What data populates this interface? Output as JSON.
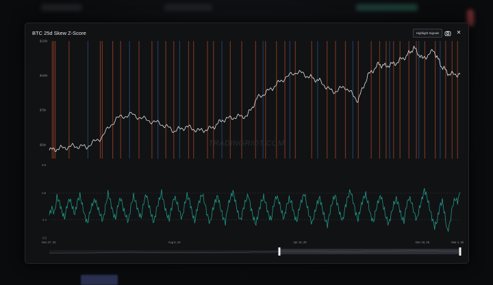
{
  "modal": {
    "title": "BTC  25d Skew Z-Score",
    "highlight_button_label": "Highlight Signals",
    "camera_icon": "camera-icon",
    "close_icon": "close-icon",
    "close_glyph": "✕"
  },
  "watermark": "TRADINGRIOT.COM",
  "colors": {
    "price_line": "#e6e6e6",
    "zscore_line": "#1f9a8a",
    "signal_red": "#c4522e",
    "signal_blue": "#2f5f96",
    "grid": "#3a3d44"
  },
  "chart_data": [
    {
      "type": "line",
      "name": "price",
      "ylim": [
        40000,
        125000
      ],
      "yticks": [
        {
          "value": 50000,
          "label": "$50k"
        },
        {
          "value": 75000,
          "label": "$75k"
        },
        {
          "value": 100000,
          "label": "$100k"
        },
        {
          "value": 125000,
          "label": "$125k"
        }
      ],
      "x": [
        "2023-11-27",
        "2023-12-20",
        "2024-01-15",
        "2024-02-10",
        "2024-03-10",
        "2024-04-10",
        "2024-05-10",
        "2024-06-10",
        "2024-07-10",
        "2024-08-05",
        "2024-08-30",
        "2024-09-25",
        "2024-10-20",
        "2024-11-10",
        "2024-12-05",
        "2024-12-30",
        "2025-01-20",
        "2025-02-15",
        "2025-03-10",
        "2025-04-10",
        "2025-05-05",
        "2025-05-25",
        "2025-06-20",
        "2025-07-15",
        "2025-08-10",
        "2025-08-30",
        "2025-09-20",
        "2025-10-06",
        "2025-10-25",
        "2025-11-15",
        "2025-12-01",
        "2025-12-18",
        "2026-01-10",
        "2026-01-25",
        "2026-02-10",
        "2026-03-04"
      ],
      "values": [
        46000,
        47500,
        49000,
        48500,
        55000,
        69000,
        72000,
        68000,
        65000,
        60000,
        63000,
        60000,
        62000,
        68000,
        70000,
        71000,
        84000,
        90000,
        97000,
        103000,
        99000,
        96000,
        88000,
        92000,
        82000,
        100000,
        108000,
        107000,
        109000,
        114000,
        120000,
        112000,
        118000,
        107000,
        101000,
        101000
      ]
    },
    {
      "type": "line",
      "name": "zscore",
      "ylim": [
        -3.1,
        5.3
      ],
      "yticks": [
        {
          "value": 4.9,
          "label": "4.9"
        },
        {
          "value": 1.8,
          "label": "1.8"
        },
        {
          "value": -1.1,
          "label": "-1.1"
        },
        {
          "value": -3.1,
          "label": "-3.1"
        }
      ],
      "dashed_levels": [
        1.8,
        -1.1
      ],
      "xticks": [
        {
          "value": "2023-11-27",
          "label": "Nov 27, 23"
        },
        {
          "value": "2024-08-05",
          "label": "Aug 5, 24"
        },
        {
          "value": "2025-04-15",
          "label": "Apr 15, 25"
        },
        {
          "value": "2025-12-18",
          "label": "Dec 18, 25"
        },
        {
          "value": "2026-03-04",
          "label": "Mar 4, 26"
        }
      ],
      "x_start": "2023-11-27",
      "x_end": "2026-03-04",
      "values": [
        -0.6,
        0.2,
        -0.4,
        1.4,
        0.8,
        -0.3,
        -0.9,
        0.5,
        1.2,
        0.3,
        -0.5,
        0.9,
        1.6,
        0.4,
        -0.8,
        -1.5,
        -0.2,
        0.7,
        1.1,
        0.2,
        -0.6,
        -1.2,
        0.3,
        1.8,
        0.9,
        -0.4,
        -1.0,
        0.6,
        1.3,
        0.1,
        -0.7,
        -1.3,
        0.4,
        1.5,
        0.7,
        -0.3,
        -0.9,
        0.8,
        1.7,
        0.5,
        -0.6,
        -1.4,
        0.0,
        1.0,
        1.9,
        0.6,
        -0.5,
        -1.1,
        0.3,
        1.4,
        0.8,
        -0.2,
        -1.0,
        0.5,
        1.6,
        1.0,
        -0.4,
        -1.3,
        0.2,
        1.1,
        1.7,
        0.6,
        -0.7,
        -1.5,
        -0.1,
        0.9,
        1.5,
        0.3,
        -0.8,
        -1.4,
        0.4,
        1.3,
        2.0,
        0.8,
        -0.5,
        -1.2,
        0.1,
        1.0,
        1.6,
        0.2,
        -0.9,
        -1.6,
        -0.3,
        0.8,
        1.4,
        0.5,
        -0.7,
        -1.1,
        0.6,
        1.5,
        0.9,
        -0.2,
        -1.0,
        0.4,
        1.2,
        0.7,
        -0.6,
        -1.3,
        0.2,
        1.1,
        1.8,
        0.4,
        -0.8,
        -1.5,
        -0.4,
        0.7,
        1.3,
        0.1,
        -1.0,
        -1.7,
        -0.2,
        0.9,
        1.6,
        0.5,
        -0.6,
        -1.2,
        0.3,
        1.4,
        2.1,
        1.0,
        -0.3,
        -1.1,
        0.2,
        1.2,
        1.7,
        0.6,
        -0.7,
        -1.4,
        0.0,
        1.0,
        1.5,
        0.3,
        -0.9,
        -1.6,
        -0.5,
        0.6,
        1.2,
        0.4,
        -0.8,
        -1.3,
        0.5,
        1.3,
        0.8,
        -0.4,
        -1.1,
        0.1,
        1.1,
        2.2,
        1.4,
        0.2,
        -0.9,
        -1.9,
        -1.2,
        0.3,
        1.0,
        -0.6,
        -2.4,
        -1.5,
        0.4,
        1.2,
        0.9,
        1.9
      ]
    }
  ],
  "signals": {
    "red_dates": [
      "2023-12-02",
      "2023-12-05",
      "2023-12-08",
      "2024-01-05",
      "2024-03-08",
      "2024-03-12",
      "2024-04-02",
      "2024-04-18",
      "2024-05-25",
      "2024-06-20",
      "2024-07-18",
      "2024-08-03",
      "2024-09-02",
      "2024-09-12",
      "2024-10-10",
      "2024-10-22",
      "2024-11-25",
      "2024-12-18",
      "2025-01-15",
      "2025-02-04",
      "2025-02-26",
      "2025-03-15",
      "2025-04-05",
      "2025-05-08",
      "2025-06-08",
      "2025-06-25",
      "2025-07-15",
      "2025-08-10",
      "2025-09-05",
      "2025-09-22",
      "2025-10-05",
      "2025-10-20",
      "2025-11-02",
      "2025-11-20",
      "2025-12-05",
      "2025-12-22",
      "2026-01-12",
      "2026-02-02",
      "2026-02-15",
      "2026-02-26"
    ],
    "blue_dates": [
      "2024-02-12",
      "2024-05-06",
      "2024-07-02",
      "2024-08-15",
      "2024-11-08",
      "2025-01-30",
      "2025-03-25",
      "2025-05-20",
      "2025-07-30",
      "2025-10-12",
      "2025-12-10",
      "2026-01-22"
    ]
  }
}
